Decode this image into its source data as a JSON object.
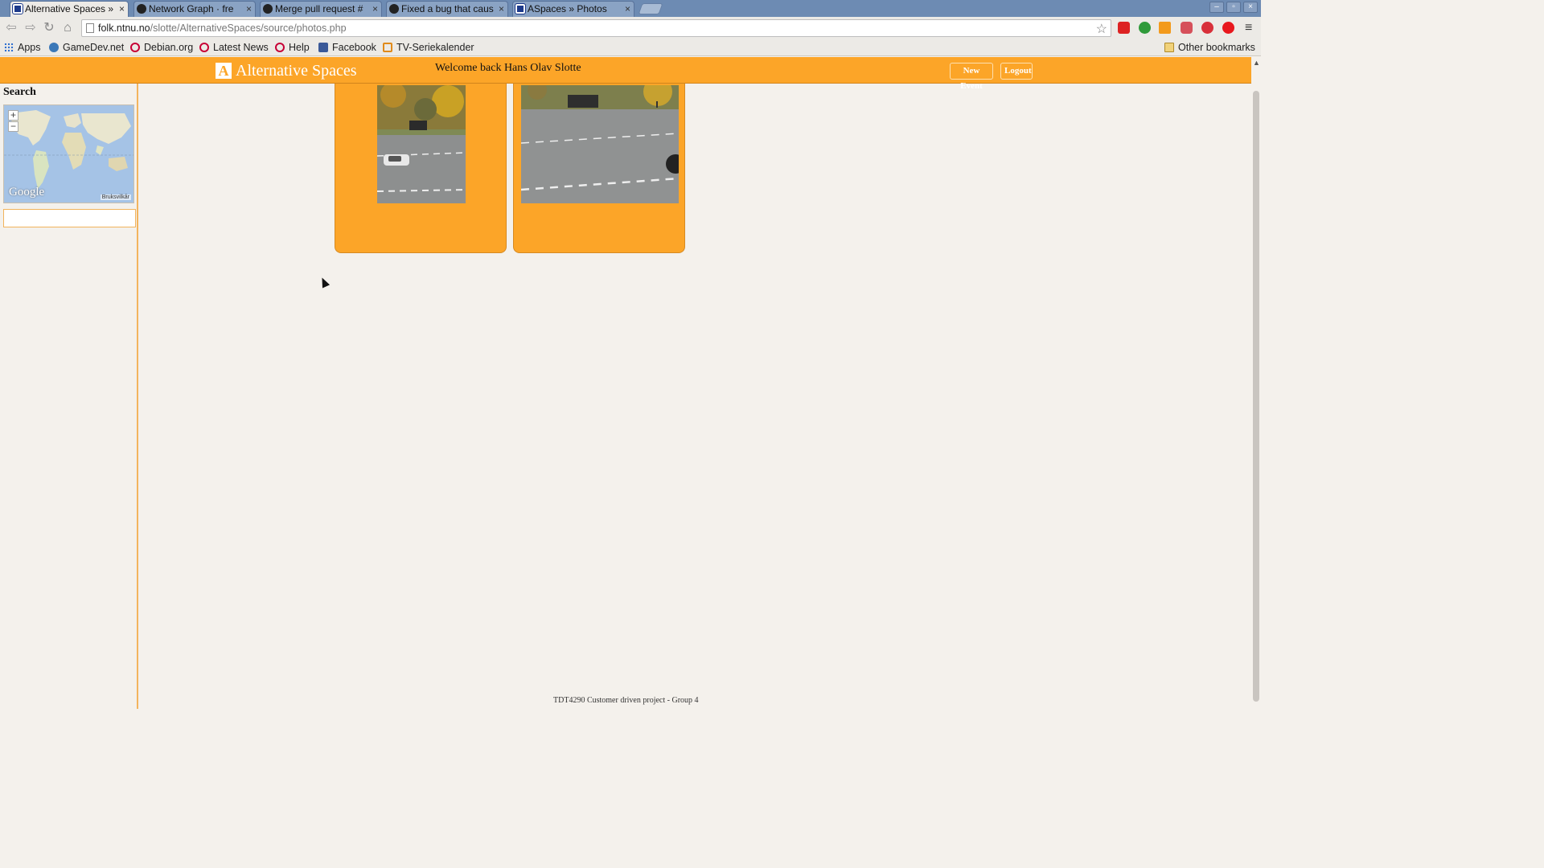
{
  "browser": {
    "tabs": [
      {
        "title": "Alternative Spaces »",
        "icon": "alternative-spaces-favicon",
        "active": true
      },
      {
        "title": "Network Graph · fre",
        "icon": "github-icon",
        "active": false
      },
      {
        "title": "Merge pull request #",
        "icon": "github-icon",
        "active": false
      },
      {
        "title": "Fixed a bug that caus",
        "icon": "github-icon",
        "active": false
      },
      {
        "title": "ASpaces » Photos",
        "icon": "alternative-spaces-favicon",
        "active": false
      }
    ],
    "tab_close": "×",
    "window_controls": {
      "minimize": "–",
      "restore": "▫",
      "close": "×"
    },
    "url_host": "folk.ntnu.no",
    "url_path": "/slotte/AlternativeSpaces/source/photos.php",
    "bookmarks": [
      {
        "label": "Apps",
        "icon": "apps-grid-icon"
      },
      {
        "label": "GameDev.net",
        "icon": "gamedev-icon"
      },
      {
        "label": "Debian.org",
        "icon": "debian-icon"
      },
      {
        "label": "Latest News",
        "icon": "debian-icon"
      },
      {
        "label": "Help",
        "icon": "debian-icon"
      },
      {
        "label": "Facebook",
        "icon": "facebook-icon"
      },
      {
        "label": "TV-Seriekalender",
        "icon": "tv-icon"
      }
    ],
    "other_bookmarks": "Other bookmarks",
    "extensions": [
      "ladybug-icon",
      "green-circle-icon",
      "rss-icon",
      "pocket-icon",
      "adblock-icon",
      "red-dot-icon"
    ],
    "menu_icon": "≡"
  },
  "site": {
    "brand_mark": "A",
    "brand_name": "Alternative Spaces",
    "welcome": "Welcome back Hans Olav Slotte",
    "new_event": "New Event",
    "logout": "Logout",
    "accent": "#fca528"
  },
  "sidebar": {
    "search_title": "Search",
    "map_logo": "Google",
    "map_terms": "Bruksvilkår",
    "zoom_in": "+",
    "zoom_out": "−",
    "search_value": ""
  },
  "photos": [
    {
      "alt": "Road with bus stop and white car, portrait"
    },
    {
      "alt": "Road with bus stop and dark car, landscape"
    }
  ],
  "footer": "TDT4290 Customer driven project - Group 4"
}
